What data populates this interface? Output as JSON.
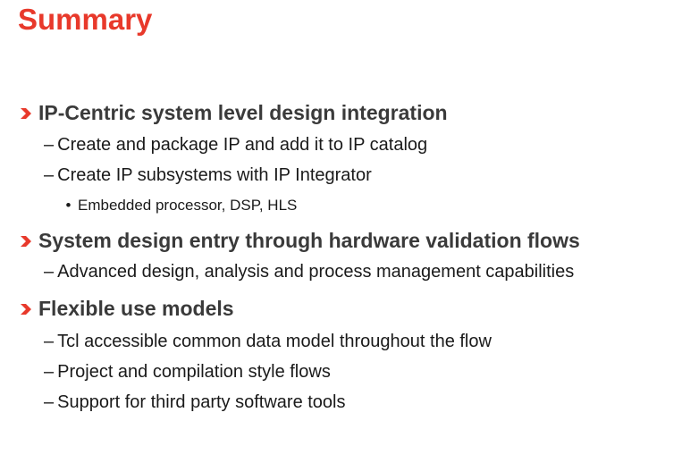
{
  "slide": {
    "title": "Summary",
    "accent_color": "#e8392b",
    "bullet_icon": "red-chevron-icon",
    "sections": [
      {
        "heading": "IP-Centric system level design integration",
        "items": [
          {
            "text": "Create and package IP and add it to IP catalog"
          },
          {
            "text": "Create IP subsystems with IP Integrator",
            "subitems": [
              "Embedded processor, DSP, HLS"
            ]
          }
        ]
      },
      {
        "heading": "System design entry through hardware validation flows",
        "items": [
          {
            "text": "Advanced design, analysis and process management capabilities"
          }
        ]
      },
      {
        "heading": "Flexible use models",
        "items": [
          {
            "text": "Tcl accessible common data model throughout the flow"
          },
          {
            "text": "Project and compilation style flows"
          },
          {
            "text": "Support for third party software tools"
          }
        ]
      }
    ]
  }
}
